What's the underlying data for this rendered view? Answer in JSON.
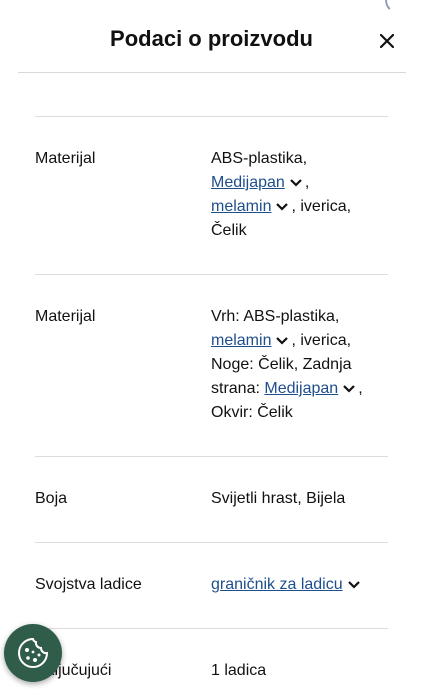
{
  "header": {
    "title": "Podaci o proizvodu"
  },
  "rows": [
    {
      "label": "Materijal"
    },
    {
      "label": "Materijal"
    },
    {
      "label": "Boja",
      "value": "Svijetli hrast, Bijela"
    },
    {
      "label": "Svojstva ladice"
    },
    {
      "label": "Uključujući",
      "value": "1 ladica"
    }
  ],
  "material1": {
    "t1": "ABS-plastika,",
    "link1": "Medijapan",
    "t2": ",",
    "link2": "melamin",
    "t3": ", iverica,",
    "t4": "Čelik"
  },
  "material2": {
    "t1": "Vrh: ABS-plastika,",
    "link1": "melamin",
    "t2": ", iverica,",
    "t3": "Noge: Čelik, Zadnja strana:",
    "link2": "Medijapan",
    "t4": ",",
    "t5": "Okvir: Čelik"
  },
  "drawer": {
    "link": "graničnik za ladicu"
  },
  "colors": {
    "link": "#1f4e8c",
    "cookie_bg": "#2f5d4a",
    "divider": "#dcdcdc"
  },
  "icons": {
    "close": "close-icon",
    "chevron": "chevron-down-icon",
    "cookie": "cookie-icon"
  }
}
